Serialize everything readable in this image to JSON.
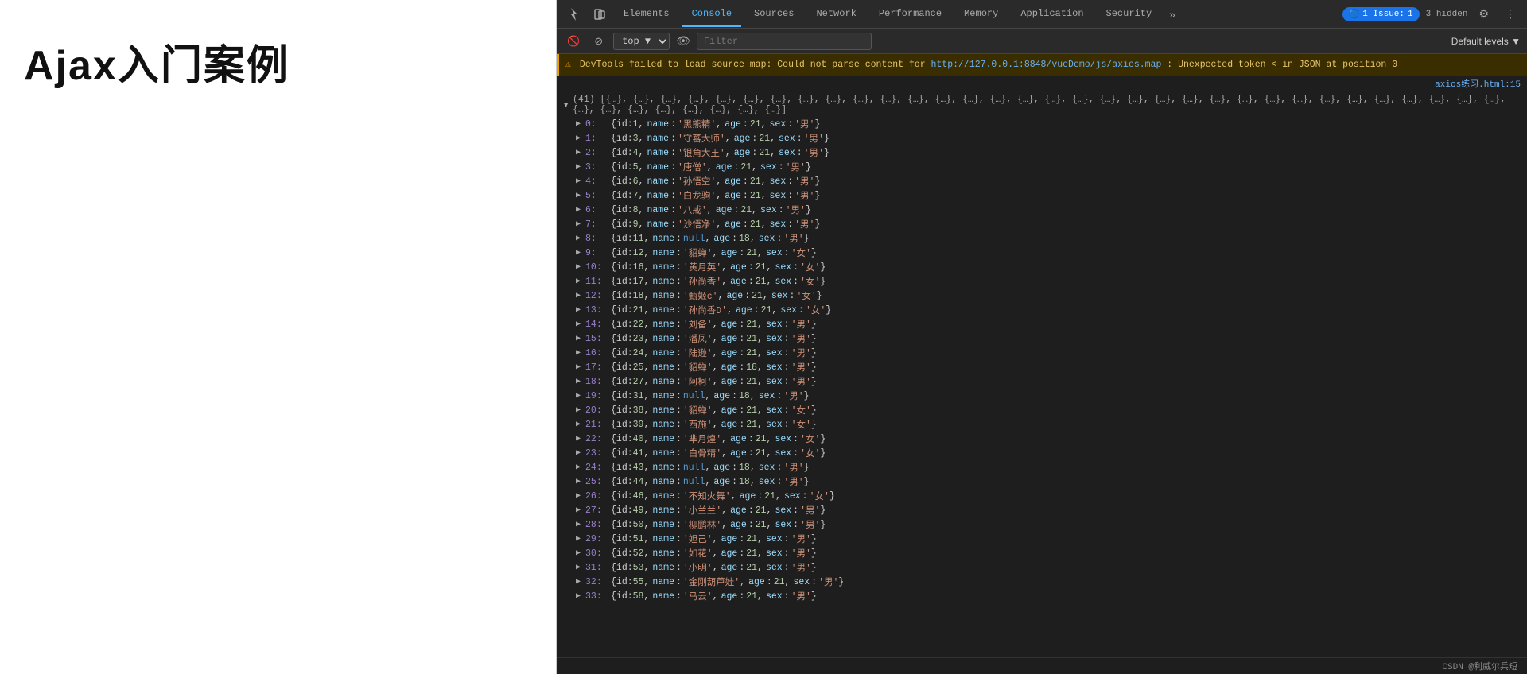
{
  "left": {
    "title": "Ajax入门案例"
  },
  "devtools": {
    "tabs": [
      {
        "id": "elements",
        "label": "Elements",
        "active": false
      },
      {
        "id": "console",
        "label": "Console",
        "active": true
      },
      {
        "id": "sources",
        "label": "Sources",
        "active": false
      },
      {
        "id": "network",
        "label": "Network",
        "active": false
      },
      {
        "id": "performance",
        "label": "Performance",
        "active": false
      },
      {
        "id": "memory",
        "label": "Memory",
        "active": false
      },
      {
        "id": "application",
        "label": "Application",
        "active": false
      },
      {
        "id": "security",
        "label": "Security",
        "active": false
      }
    ],
    "toolbar_icons": {
      "cursor": "⬚",
      "device": "□",
      "more": "»"
    },
    "right_badges": {
      "issues_label": "1 Issue:",
      "issues_count": "1",
      "hidden_label": "3 hidden",
      "settings": "⚙",
      "more": "⋮"
    },
    "console_bar": {
      "top_label": "top ▼",
      "filter_placeholder": "Filter",
      "default_levels": "Default levels ▼"
    },
    "warning": {
      "text1": "DevTools failed to load source map: Could not parse content for ",
      "url": "http://127.0.0.1:8848/vueDemo/js/axios.map",
      "text2": ": Unexpected token < in JSON at position 0"
    },
    "source_link": "axios练习.html:15",
    "array_summary": "(41) [{…}, {…}, {…}, {…}, {…}, {…}, {…}, {…}, {…}, {…}, {…}, {…}, {…}, {…}, {…}, {…}, {…}, {…}, {…}, {…}, {…}, {…}, {…}, {…}, {…}, {…}, {…}, {…}, {…}, {…}, {…}, {…}, {…}, {…}, {…}, {…}, {…}, {…}, {…}, {…}, {…}]",
    "rows": [
      {
        "index": "0",
        "id": 1,
        "name": "'黑熊精'",
        "age": 21,
        "sex": "'男'"
      },
      {
        "index": "1",
        "id": 3,
        "name": "'守蕃大师'",
        "age": 21,
        "sex": "'男'"
      },
      {
        "index": "2",
        "id": 4,
        "name": "'银角大王'",
        "age": 21,
        "sex": "'男'"
      },
      {
        "index": "3",
        "id": 5,
        "name": "'唐僧'",
        "age": 21,
        "sex": "'男'"
      },
      {
        "index": "4",
        "id": 6,
        "name": "'孙悟空'",
        "age": 21,
        "sex": "'男'"
      },
      {
        "index": "5",
        "id": 7,
        "name": "'白龙驹'",
        "age": 21,
        "sex": "'男'"
      },
      {
        "index": "6",
        "id": 8,
        "name": "'八戒'",
        "age": 21,
        "sex": "'男'"
      },
      {
        "index": "7",
        "id": 9,
        "name": "'沙悟净'",
        "age": 21,
        "sex": "'男'"
      },
      {
        "index": "8",
        "id": 11,
        "name": "null",
        "age": 18,
        "sex": "'男'",
        "name_null": true
      },
      {
        "index": "9",
        "id": 12,
        "name": "'貂蝉'",
        "age": 21,
        "sex": "'女'"
      },
      {
        "index": "10",
        "id": 16,
        "name": "'黄月英'",
        "age": 21,
        "sex": "'女'"
      },
      {
        "index": "11",
        "id": 17,
        "name": "'孙尚香'",
        "age": 21,
        "sex": "'女'"
      },
      {
        "index": "12",
        "id": 18,
        "name": "'甄姬c'",
        "age": 21,
        "sex": "'女'"
      },
      {
        "index": "13",
        "id": 21,
        "name": "'孙尚香D'",
        "age": 21,
        "sex": "'女'"
      },
      {
        "index": "14",
        "id": 22,
        "name": "'刘备'",
        "age": 21,
        "sex": "'男'"
      },
      {
        "index": "15",
        "id": 23,
        "name": "'潘凤'",
        "age": 21,
        "sex": "'男'"
      },
      {
        "index": "16",
        "id": 24,
        "name": "'陆逊'",
        "age": 21,
        "sex": "'男'"
      },
      {
        "index": "17",
        "id": 25,
        "name": "'貂蝉'",
        "age": 18,
        "sex": "'男'"
      },
      {
        "index": "18",
        "id": 27,
        "name": "'阿柯'",
        "age": 21,
        "sex": "'男'"
      },
      {
        "index": "19",
        "id": 31,
        "name": "null",
        "age": 18,
        "sex": "'男'",
        "name_null": true
      },
      {
        "index": "20",
        "id": 38,
        "name": "'貂蝉'",
        "age": 21,
        "sex": "'女'"
      },
      {
        "index": "21",
        "id": 39,
        "name": "'西施'",
        "age": 21,
        "sex": "'女'"
      },
      {
        "index": "22",
        "id": 40,
        "name": "'芈月煌'",
        "age": 21,
        "sex": "'女'"
      },
      {
        "index": "23",
        "id": 41,
        "name": "'白骨精'",
        "age": 21,
        "sex": "'女'"
      },
      {
        "index": "24",
        "id": 43,
        "name": "null",
        "age": 18,
        "sex": "'男'",
        "name_null": true
      },
      {
        "index": "25",
        "id": 44,
        "name": "null",
        "age": 18,
        "sex": "'男'",
        "name_null": true
      },
      {
        "index": "26",
        "id": 46,
        "name": "'不知火舞'",
        "age": 21,
        "sex": "'女'"
      },
      {
        "index": "27",
        "id": 49,
        "name": "'小兰兰'",
        "age": 21,
        "sex": "'男'"
      },
      {
        "index": "28",
        "id": 50,
        "name": "'柳鹏林'",
        "age": 21,
        "sex": "'男'"
      },
      {
        "index": "29",
        "id": 51,
        "name": "'妲己'",
        "age": 21,
        "sex": "'男'"
      },
      {
        "index": "30",
        "id": 52,
        "name": "'如花'",
        "age": 21,
        "sex": "'男'"
      },
      {
        "index": "31",
        "id": 53,
        "name": "'小明'",
        "age": 21,
        "sex": "'男'"
      },
      {
        "index": "32",
        "id": 55,
        "name": "'金刚葫芦娃'",
        "age": 21,
        "sex": "'男'"
      },
      {
        "index": "33",
        "id": 58,
        "name": "'马云'",
        "age": 21,
        "sex": "'男'"
      }
    ],
    "watermark": "CSDN @利威尔兵短"
  }
}
